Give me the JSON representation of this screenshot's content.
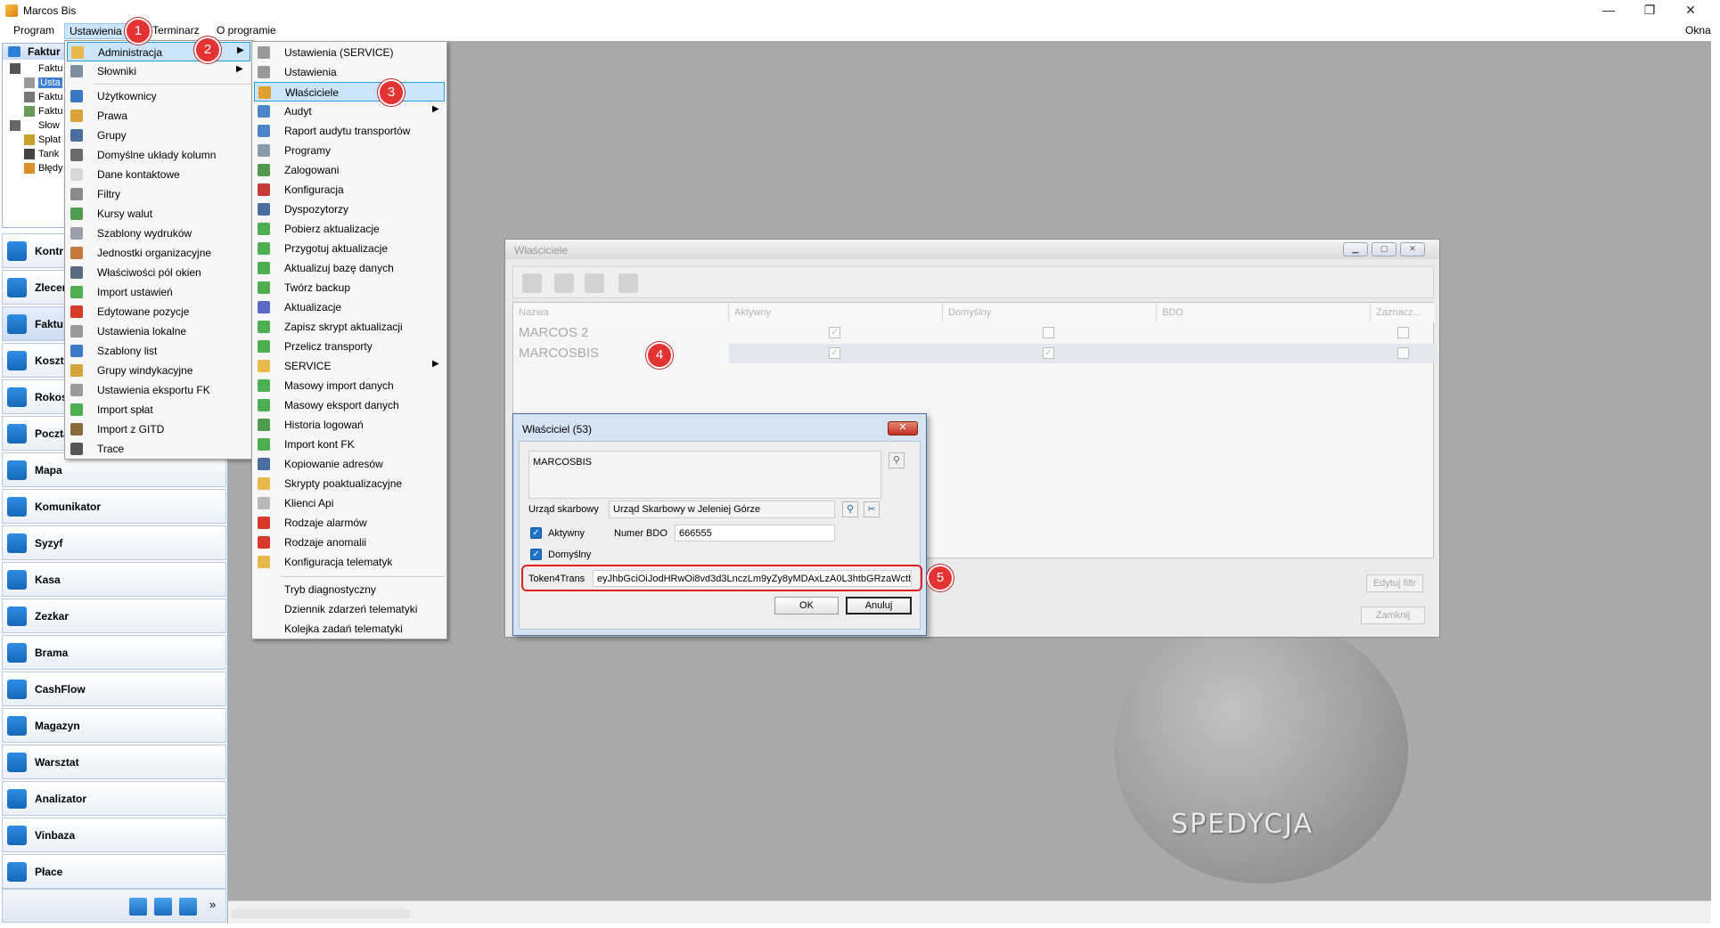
{
  "window": {
    "title": "Marcos Bis",
    "minimize": "—",
    "restore": "❐",
    "close": "✕"
  },
  "menubar": {
    "items": [
      "Program",
      "Ustawienia",
      "Terminarz",
      "O programie"
    ],
    "right": "Okna"
  },
  "tree": {
    "header": "Faktur",
    "rows": [
      "Faktu",
      "Usta",
      "Faktu",
      "Faktu",
      "Słow",
      "Spłat",
      "Tank",
      "Błędy"
    ]
  },
  "nav": {
    "items": [
      "Kontr",
      "Zlecer",
      "Faktu",
      "Koszty",
      "Rokos",
      "Poczta",
      "Mapa",
      "Komunikator",
      "Syzyf",
      "Kasa",
      "Zezkar",
      "Brama",
      "CashFlow",
      "Magazyn",
      "Warsztat",
      "Analizator",
      "Vinbaza",
      "Płace"
    ],
    "footer_more": "»"
  },
  "menu_ustawienia": {
    "items": [
      "Administracja",
      "Słowniki",
      "Użytkownicy",
      "Prawa",
      "Grupy",
      "Domyślne układy kolumn",
      "Dane kontaktowe",
      "Filtry",
      "Kursy walut",
      "Szablony wydruków",
      "Jednostki organizacyjne",
      "Właściwości pól okien",
      "Import ustawień",
      "Edytowane pozycje",
      "Ustawienia lokalne",
      "Szablony list",
      "Grupy windykacyjne",
      "Ustawienia eksportu FK",
      "Import spłat",
      "Import z GITD",
      "Trace"
    ]
  },
  "menu_administracja": {
    "items": [
      "Ustawienia (SERVICE)",
      "Ustawienia",
      "Właściciele",
      "Audyt",
      "Raport audytu transportów",
      "Programy",
      "Zalogowani",
      "Konfiguracja",
      "Dyspozytorzy",
      "Pobierz aktualizacje",
      "Przygotuj aktualizacje",
      "Aktualizuj bazę danych",
      "Twórz backup",
      "Aktualizacje",
      "Zapisz skrypt aktualizacji",
      "Przelicz transporty",
      "SERVICE",
      "Masowy import danych",
      "Masowy eksport danych",
      "Historia logowań",
      "Import kont FK",
      "Kopiowanie adresów",
      "Skrypty poaktualizacyjne",
      "Klienci Api",
      "Rodzaje alarmów",
      "Rodzaje anomalii",
      "Konfiguracja telematyk",
      "Tryb diagnostyczny",
      "Dziennik zdarzeń telematyki",
      "Kolejka zadań telematyki"
    ]
  },
  "owners_window": {
    "title": "Właściciele",
    "columns": [
      "Nazwa",
      "Aktywny",
      "Domyślny",
      "BDO",
      "Zaznacz..."
    ],
    "rows": [
      {
        "name": "MARCOS 2",
        "active": true,
        "default": false,
        "selected": false
      },
      {
        "name": "MARCOSBIS",
        "active": true,
        "default": true,
        "selected": false
      }
    ],
    "edit_filter": "Edytuj filtr",
    "close": "Zamknij"
  },
  "owner_dialog": {
    "title": "Właściciel (53)",
    "name": "MARCOSBIS",
    "tax_office_label": "Urząd skarbowy",
    "tax_office_value": "Urząd Skarbowy w Jeleniej Górze",
    "active_label": "Aktywny",
    "bdo_label": "Numer BDO",
    "bdo_value": "666555",
    "default_label": "Domyślny",
    "token_label": "Token4Trans",
    "token_value": "eyJhbGciOiJodHRwOi8vd3d3LnczLm9yZy8yMDAxLzA0L3htbGRzaWctb",
    "ok": "OK",
    "cancel": "Anuluj"
  },
  "callouts": [
    "1",
    "2",
    "3",
    "4",
    "5"
  ],
  "brand": "SPEDYCJA",
  "colors": {
    "accent": "#e53333",
    "highlight": "#cce4f7",
    "nav_icon": "#1e73c8"
  }
}
